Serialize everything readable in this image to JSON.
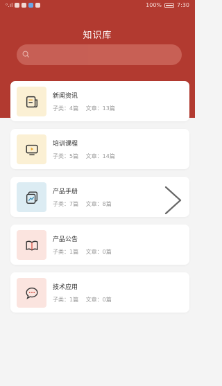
{
  "status_bar": {
    "signal": "ᵒ.ıl",
    "battery_text": "100%",
    "time": "7:30"
  },
  "header": {
    "title": "知识库",
    "search_placeholder": ""
  },
  "categories": [
    {
      "name": "新闻资讯",
      "subcategory_label": "子类：",
      "subcategory_count": "4篇",
      "article_label": "文章：",
      "article_count": "13篇",
      "icon": "news-icon"
    },
    {
      "name": "培训课程",
      "subcategory_label": "子类：",
      "subcategory_count": "5篇",
      "article_label": "文章：",
      "article_count": "14篇",
      "icon": "video-course-icon"
    },
    {
      "name": "产品手册",
      "subcategory_label": "子类：",
      "subcategory_count": "7篇",
      "article_label": "文章：",
      "article_count": "8篇",
      "icon": "manual-icon"
    },
    {
      "name": "产品公告",
      "subcategory_label": "子类：",
      "subcategory_count": "1篇",
      "article_label": "文章：",
      "article_count": "0篇",
      "icon": "book-icon"
    },
    {
      "name": "技术应用",
      "subcategory_label": "子类：",
      "subcategory_count": "1篇",
      "article_label": "文章：",
      "article_count": "0篇",
      "icon": "chat-icon"
    }
  ],
  "colors": {
    "header_bg": "#b23a30",
    "page_bg": "#f4f4f4",
    "icon_yellow_bg": "#fbf0d4",
    "icon_blue_bg": "#dcecf3",
    "icon_pink_bg": "#fbe4df"
  }
}
